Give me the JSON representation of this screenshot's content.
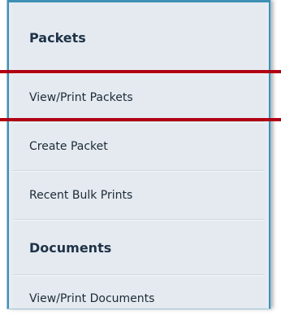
{
  "sidebar": {
    "sections": [
      {
        "heading": "Packets",
        "items": [
          {
            "label": "View/Print Packets",
            "highlighted": true
          },
          {
            "label": "Create Packet"
          },
          {
            "label": "Recent Bulk Prints"
          }
        ]
      },
      {
        "heading": "Documents",
        "items": [
          {
            "label": "View/Print Documents"
          }
        ]
      }
    ]
  },
  "colors": {
    "panel_border": "#3f8fb5",
    "panel_background": "#e6ecf2",
    "highlight_line": "#b00012"
  }
}
